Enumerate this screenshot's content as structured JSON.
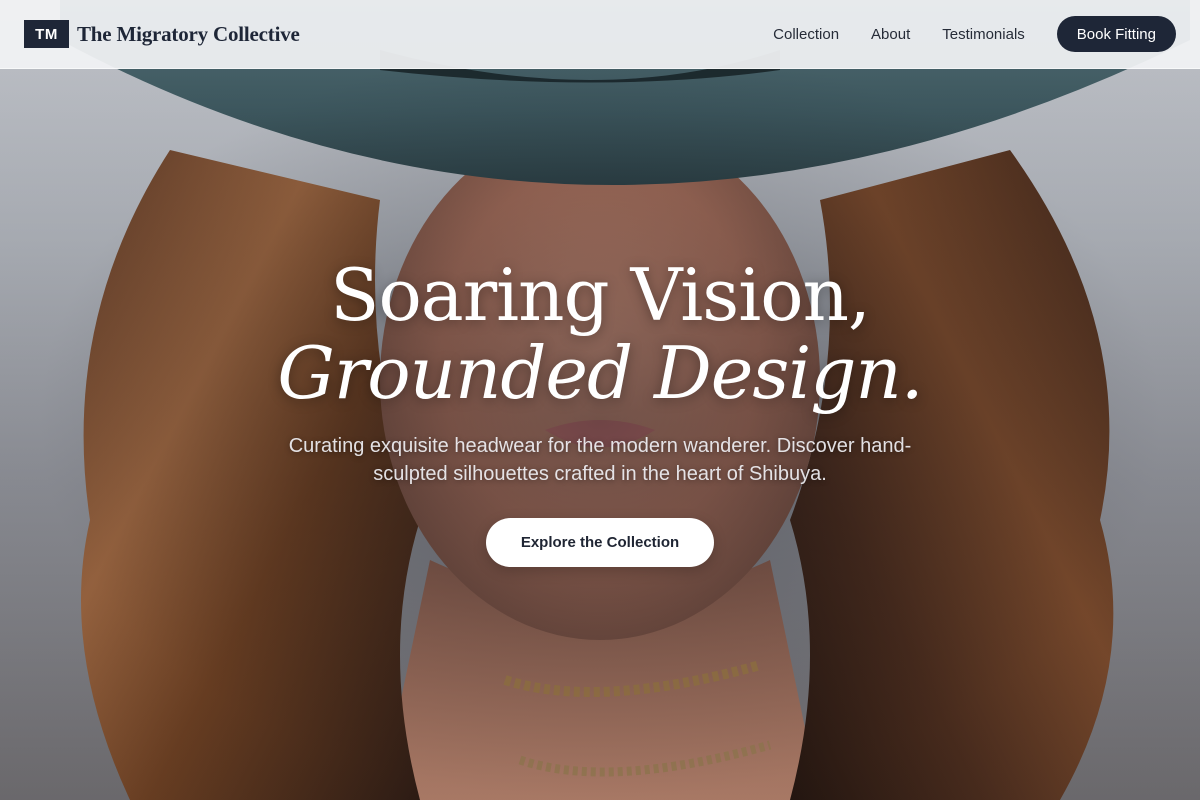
{
  "brand": {
    "mark": "TM",
    "name": "The Migratory Collective"
  },
  "nav": {
    "links": [
      {
        "label": "Collection"
      },
      {
        "label": "About"
      },
      {
        "label": "Testimonials"
      }
    ],
    "cta_label": "Book Fitting"
  },
  "hero": {
    "headline_line1": "Soaring Vision,",
    "headline_line2": "Grounded Design.",
    "subtitle": "Curating exquisite headwear for the modern wanderer. Discover hand-sculpted silhouettes crafted in the heart of Shibuya.",
    "cta_label": "Explore the Collection",
    "background_image": "woman-in-teal-hat-photo"
  },
  "colors": {
    "brand_navy": "#1e2637",
    "navbar_bg": "#f2f3f5",
    "hat_teal": "#3f5a61",
    "hair_brown": "#6b3f22",
    "cta_text": "#1f2533"
  }
}
